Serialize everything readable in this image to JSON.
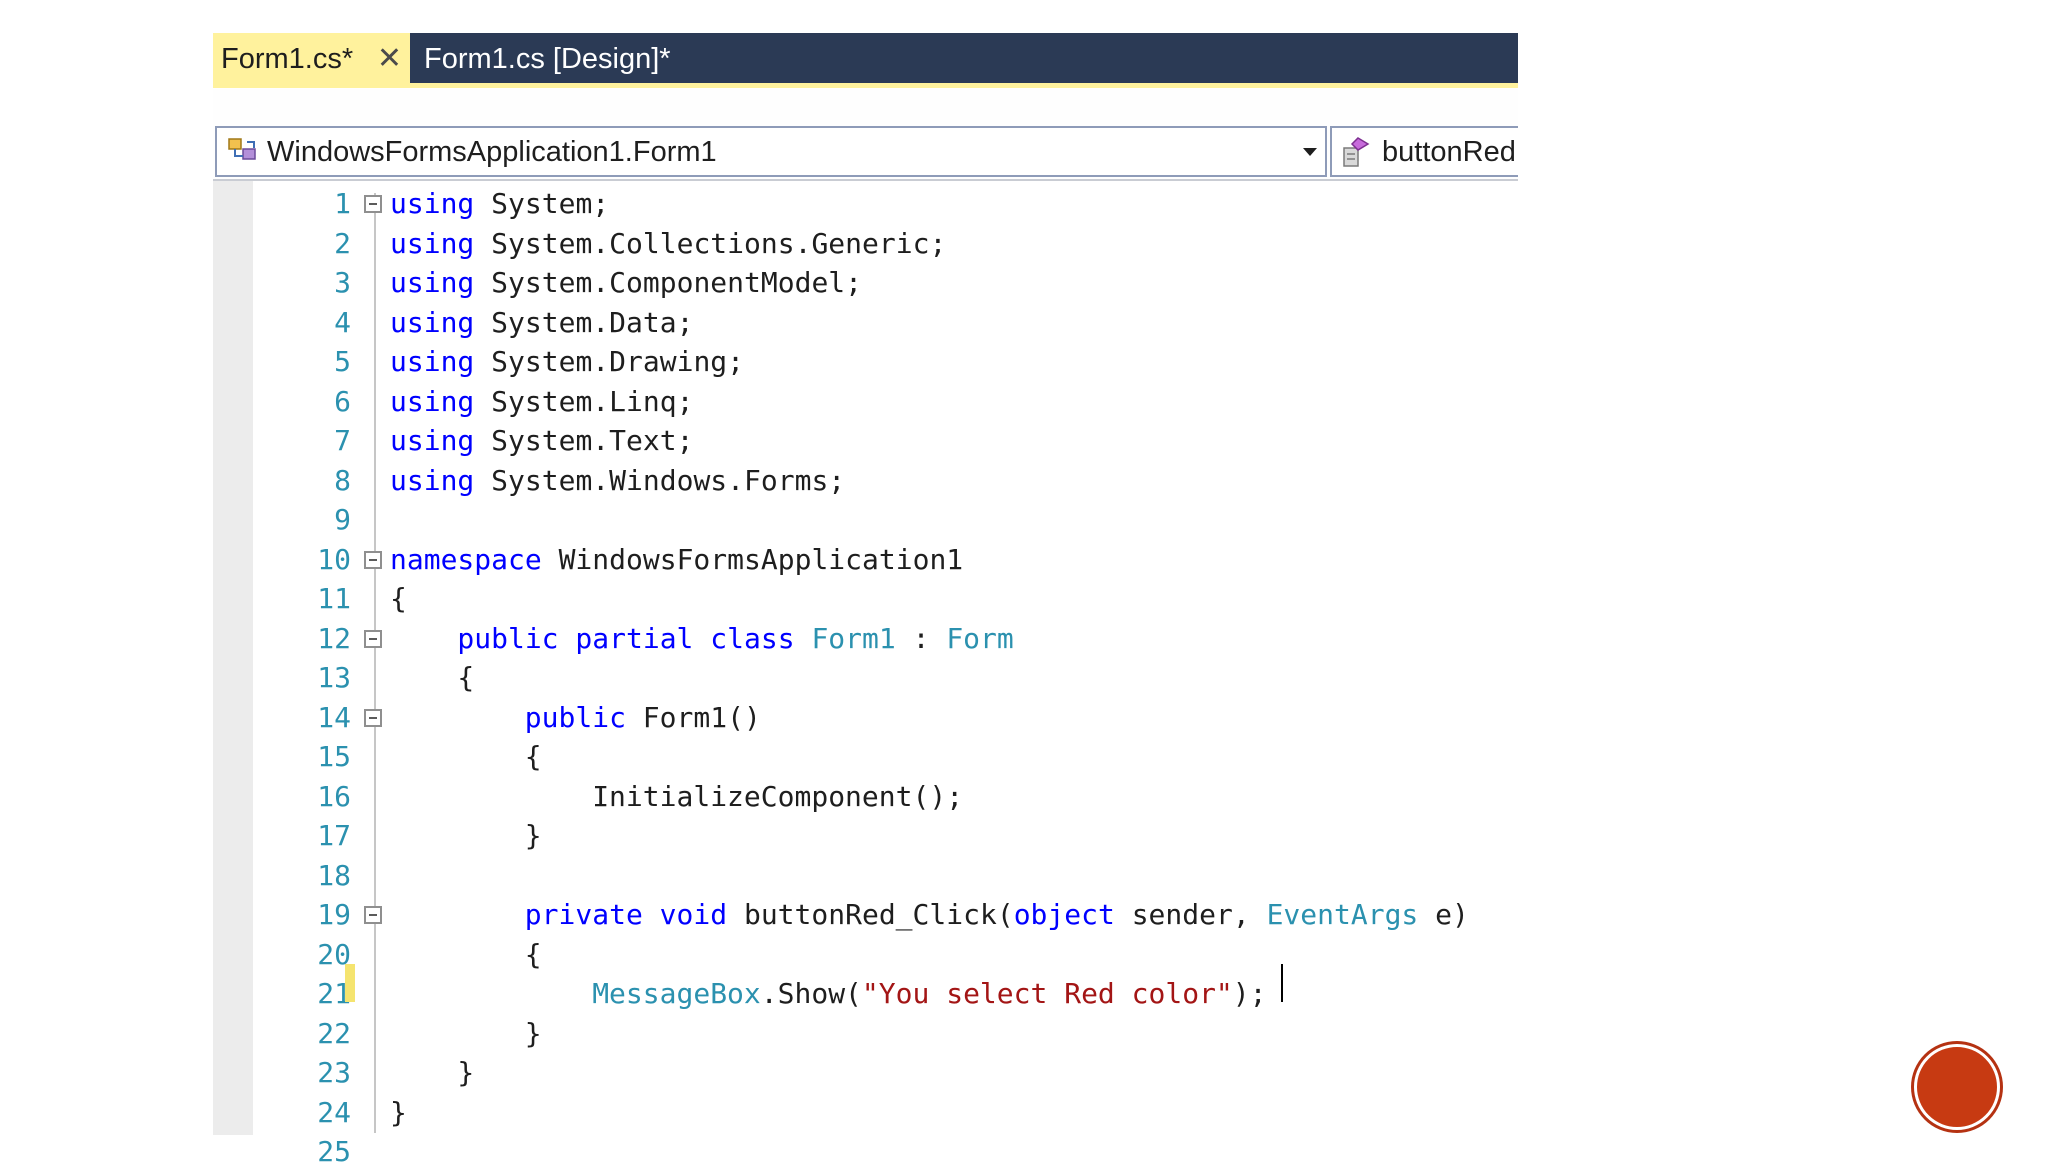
{
  "colors": {
    "tab_active_bg": "#fff29d",
    "tab_strip_bg": "#2b3a55",
    "keyword": "#0000ff",
    "type": "#2b91af",
    "string": "#a31515",
    "line_number": "#2b91af",
    "change_marker": "#f5e46f",
    "badge": "#c73a12"
  },
  "tabs": {
    "active": {
      "label": "Form1.cs*",
      "close_icon": "close-icon"
    },
    "design": {
      "label": "Form1.cs [Design]*"
    }
  },
  "navbar": {
    "class_selector": {
      "value": "WindowsFormsApplication1.Form1",
      "icon": "class-icon"
    },
    "member_selector": {
      "value": "buttonRed",
      "icon": "member-icon"
    }
  },
  "editor": {
    "active_line": 21,
    "lines": [
      {
        "n": "1",
        "fold": true,
        "indent": 0,
        "tokens": [
          {
            "t": "using",
            "k": "kw"
          },
          {
            "t": " System;",
            "k": "pl"
          }
        ]
      },
      {
        "n": "2",
        "fold": false,
        "indent": 0,
        "tokens": [
          {
            "t": "using",
            "k": "kw"
          },
          {
            "t": " System.Collections.Generic;",
            "k": "pl"
          }
        ]
      },
      {
        "n": "3",
        "fold": false,
        "indent": 0,
        "tokens": [
          {
            "t": "using",
            "k": "kw"
          },
          {
            "t": " System.ComponentModel;",
            "k": "pl"
          }
        ]
      },
      {
        "n": "4",
        "fold": false,
        "indent": 0,
        "tokens": [
          {
            "t": "using",
            "k": "kw"
          },
          {
            "t": " System.Data;",
            "k": "pl"
          }
        ]
      },
      {
        "n": "5",
        "fold": false,
        "indent": 0,
        "tokens": [
          {
            "t": "using",
            "k": "kw"
          },
          {
            "t": " System.Drawing;",
            "k": "pl"
          }
        ]
      },
      {
        "n": "6",
        "fold": false,
        "indent": 0,
        "tokens": [
          {
            "t": "using",
            "k": "kw"
          },
          {
            "t": " System.Linq;",
            "k": "pl"
          }
        ]
      },
      {
        "n": "7",
        "fold": false,
        "indent": 0,
        "tokens": [
          {
            "t": "using",
            "k": "kw"
          },
          {
            "t": " System.Text;",
            "k": "pl"
          }
        ]
      },
      {
        "n": "8",
        "fold": false,
        "indent": 0,
        "tokens": [
          {
            "t": "using",
            "k": "kw"
          },
          {
            "t": " System.Windows.Forms;",
            "k": "pl"
          }
        ]
      },
      {
        "n": "9",
        "fold": false,
        "indent": 0,
        "tokens": []
      },
      {
        "n": "10",
        "fold": true,
        "indent": 0,
        "tokens": [
          {
            "t": "namespace",
            "k": "kw"
          },
          {
            "t": " WindowsFormsApplication1",
            "k": "pl"
          }
        ]
      },
      {
        "n": "11",
        "fold": false,
        "indent": 0,
        "tokens": [
          {
            "t": "{",
            "k": "pl"
          }
        ]
      },
      {
        "n": "12",
        "fold": true,
        "indent": 4,
        "tokens": [
          {
            "t": "public",
            "k": "kw"
          },
          {
            "t": " ",
            "k": "pl"
          },
          {
            "t": "partial",
            "k": "kw"
          },
          {
            "t": " ",
            "k": "pl"
          },
          {
            "t": "class",
            "k": "kw"
          },
          {
            "t": " ",
            "k": "pl"
          },
          {
            "t": "Form1",
            "k": "ty"
          },
          {
            "t": " : ",
            "k": "pl"
          },
          {
            "t": "Form",
            "k": "ty"
          }
        ]
      },
      {
        "n": "13",
        "fold": false,
        "indent": 4,
        "tokens": [
          {
            "t": "{",
            "k": "pl"
          }
        ]
      },
      {
        "n": "14",
        "fold": true,
        "indent": 8,
        "tokens": [
          {
            "t": "public",
            "k": "kw"
          },
          {
            "t": " Form1()",
            "k": "pl"
          }
        ]
      },
      {
        "n": "15",
        "fold": false,
        "indent": 8,
        "tokens": [
          {
            "t": "{",
            "k": "pl"
          }
        ]
      },
      {
        "n": "16",
        "fold": false,
        "indent": 12,
        "tokens": [
          {
            "t": "InitializeComponent();",
            "k": "pl"
          }
        ]
      },
      {
        "n": "17",
        "fold": false,
        "indent": 8,
        "tokens": [
          {
            "t": "}",
            "k": "pl"
          }
        ]
      },
      {
        "n": "18",
        "fold": false,
        "indent": 0,
        "tokens": []
      },
      {
        "n": "19",
        "fold": true,
        "indent": 8,
        "tokens": [
          {
            "t": "private",
            "k": "kw"
          },
          {
            "t": " ",
            "k": "pl"
          },
          {
            "t": "void",
            "k": "kw"
          },
          {
            "t": " buttonRed_Click(",
            "k": "pl"
          },
          {
            "t": "object",
            "k": "kw"
          },
          {
            "t": " sender, ",
            "k": "pl"
          },
          {
            "t": "EventArgs",
            "k": "ty"
          },
          {
            "t": " e)",
            "k": "pl"
          }
        ]
      },
      {
        "n": "20",
        "fold": false,
        "indent": 8,
        "tokens": [
          {
            "t": "{",
            "k": "pl"
          }
        ]
      },
      {
        "n": "21",
        "fold": false,
        "indent": 12,
        "tokens": [
          {
            "t": "MessageBox",
            "k": "ty"
          },
          {
            "t": ".Show(",
            "k": "pl"
          },
          {
            "t": "\"You select Red color\"",
            "k": "str"
          },
          {
            "t": ");",
            "k": "pl"
          }
        ]
      },
      {
        "n": "22",
        "fold": false,
        "indent": 8,
        "tokens": [
          {
            "t": "}",
            "k": "pl"
          }
        ]
      },
      {
        "n": "23",
        "fold": false,
        "indent": 4,
        "tokens": [
          {
            "t": "}",
            "k": "pl"
          }
        ]
      },
      {
        "n": "24",
        "fold": false,
        "indent": 0,
        "tokens": [
          {
            "t": "}",
            "k": "pl"
          }
        ]
      },
      {
        "n": "25",
        "fold": false,
        "indent": 0,
        "tokens": []
      }
    ]
  }
}
